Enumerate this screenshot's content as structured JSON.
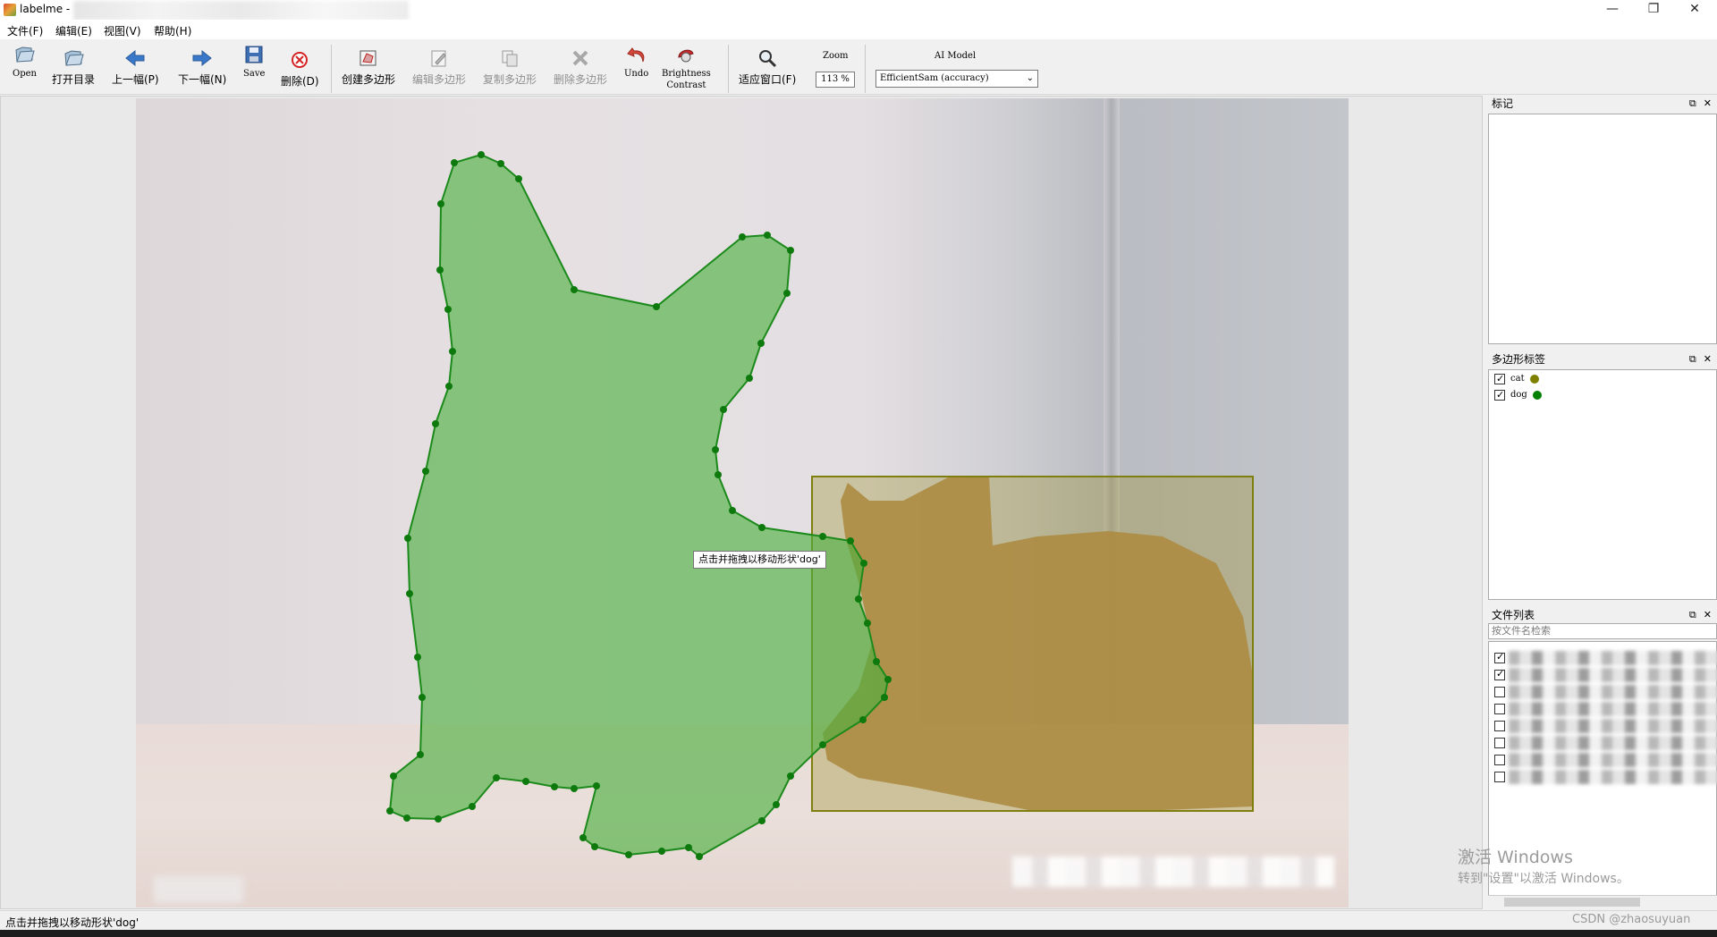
{
  "window": {
    "title": "labelme -",
    "controls": {
      "minimize": "—",
      "restore": "❐",
      "close": "✕"
    }
  },
  "menu": [
    "文件(F)",
    "编辑(E)",
    "视图(V)",
    "帮助(H)"
  ],
  "toolbar": {
    "open": "Open",
    "open_dir": "打开目录",
    "prev": "上一幅(P)",
    "next": "下一幅(N)",
    "save": "Save",
    "delete_file": "删除(D)",
    "create_polygon": "创建多边形",
    "edit_polygon": "编辑多边形",
    "copy_polygon": "复制多边形",
    "delete_polygon": "删除多边形",
    "undo": "Undo",
    "brightness_line1": "Brightness",
    "brightness_line2": "Contrast",
    "fit_window": "适应窗口(F)",
    "zoom_label": "Zoom",
    "zoom_value": "113 %",
    "ai_model_label": "AI Model",
    "ai_model_value": "EfficientSam (accuracy)"
  },
  "canvas": {
    "tooltip": "点击并拖拽以移动形状'dog'",
    "shapes": [
      {
        "label": "dog",
        "type": "polygon",
        "color": "#1b8a1b"
      },
      {
        "label": "cat",
        "type": "rectangle",
        "color": "#7f7f10"
      }
    ]
  },
  "docks": {
    "flags": {
      "title": "标记"
    },
    "polygon_labels": {
      "title": "多边形标签",
      "items": [
        {
          "label": "cat",
          "checked": true,
          "color": "#808000"
        },
        {
          "label": "dog",
          "checked": true,
          "color": "#008000"
        }
      ]
    },
    "file_list": {
      "title": "文件列表",
      "search_placeholder": "按文件名检索",
      "rows": [
        {
          "checked": true
        },
        {
          "checked": true
        },
        {
          "checked": false
        },
        {
          "checked": false
        },
        {
          "checked": false
        },
        {
          "checked": false
        },
        {
          "checked": false
        },
        {
          "checked": false
        }
      ]
    }
  },
  "watermark": {
    "line1": "激活 Windows",
    "line2": "转到\"设置\"以激活 Windows。"
  },
  "csdn": "CSDN @zhaosuyuan",
  "status": "点击并拖拽以移动形状'dog'"
}
